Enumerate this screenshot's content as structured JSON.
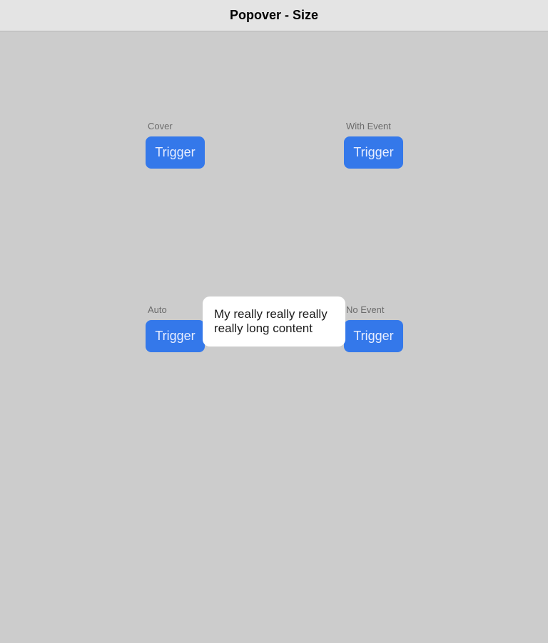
{
  "header": {
    "title": "Popover - Size"
  },
  "groups": [
    {
      "label": "Cover",
      "button": "Trigger"
    },
    {
      "label": "With Event",
      "button": "Trigger"
    },
    {
      "label": "Auto",
      "button": "Trigger"
    },
    {
      "label": "No Event",
      "button": "Trigger"
    }
  ],
  "popover": {
    "content": "My really really really really long content"
  }
}
